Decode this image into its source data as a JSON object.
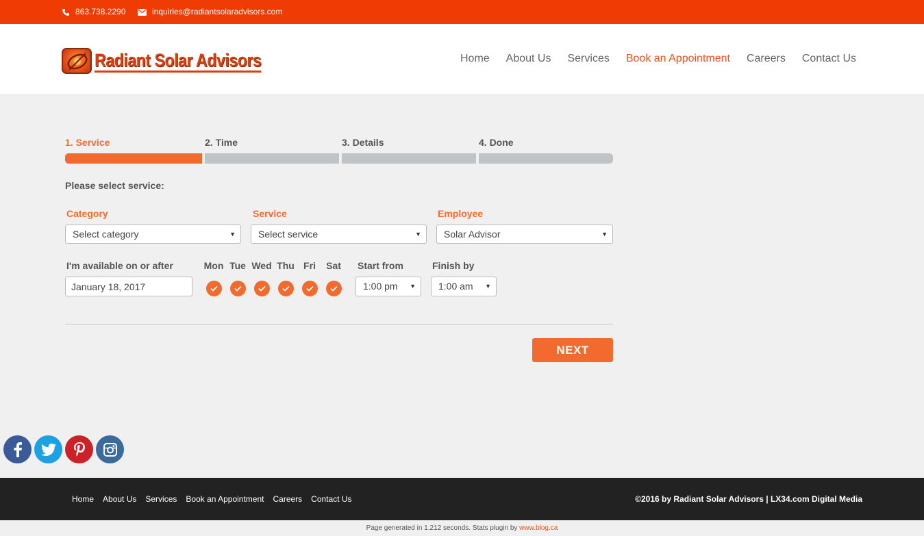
{
  "topbar": {
    "phone": "863.738.2290",
    "email": "inquiries@radiantsolaradvisors.com"
  },
  "brand": {
    "name": "Radiant Solar Advisors",
    "accent": "#ef3b04",
    "orange": "#f26a2e"
  },
  "nav": {
    "items": [
      "Home",
      "About Us",
      "Services",
      "Book an Appointment",
      "Careers",
      "Contact Us"
    ],
    "active": "Book an Appointment"
  },
  "steps": [
    {
      "label": "1. Service",
      "active": true
    },
    {
      "label": "2. Time",
      "active": false
    },
    {
      "label": "3. Details",
      "active": false
    },
    {
      "label": "4. Done",
      "active": false
    }
  ],
  "form": {
    "prompt": "Please select service:",
    "category": {
      "label": "Category",
      "value": "Select category"
    },
    "service": {
      "label": "Service",
      "value": "Select service"
    },
    "employee": {
      "label": "Employee",
      "value": "Solar Advisor"
    },
    "available_label": "I'm available on or after",
    "date_value": "January 18, 2017",
    "days": [
      {
        "name": "Mon",
        "checked": true
      },
      {
        "name": "Tue",
        "checked": true
      },
      {
        "name": "Wed",
        "checked": true
      },
      {
        "name": "Thu",
        "checked": true
      },
      {
        "name": "Fri",
        "checked": true
      },
      {
        "name": "Sat",
        "checked": true
      }
    ],
    "start_label": "Start from",
    "start_value": "1:00 pm",
    "finish_label": "Finish by",
    "finish_value": "1:00 am",
    "next_label": "NEXT"
  },
  "social": [
    "facebook-icon",
    "twitter-icon",
    "pinterest-icon",
    "instagram-icon"
  ],
  "footer": {
    "nav": [
      "Home",
      "About Us",
      "Services",
      "Book an Appointment",
      "Careers",
      "Contact Us"
    ],
    "copyright": "©2016 by Radiant Solar Advisors | LX34.com Digital Media"
  },
  "stats": {
    "text": "Page generated in 1.212 seconds. Stats plugin by ",
    "link": "www.blog.ca"
  }
}
